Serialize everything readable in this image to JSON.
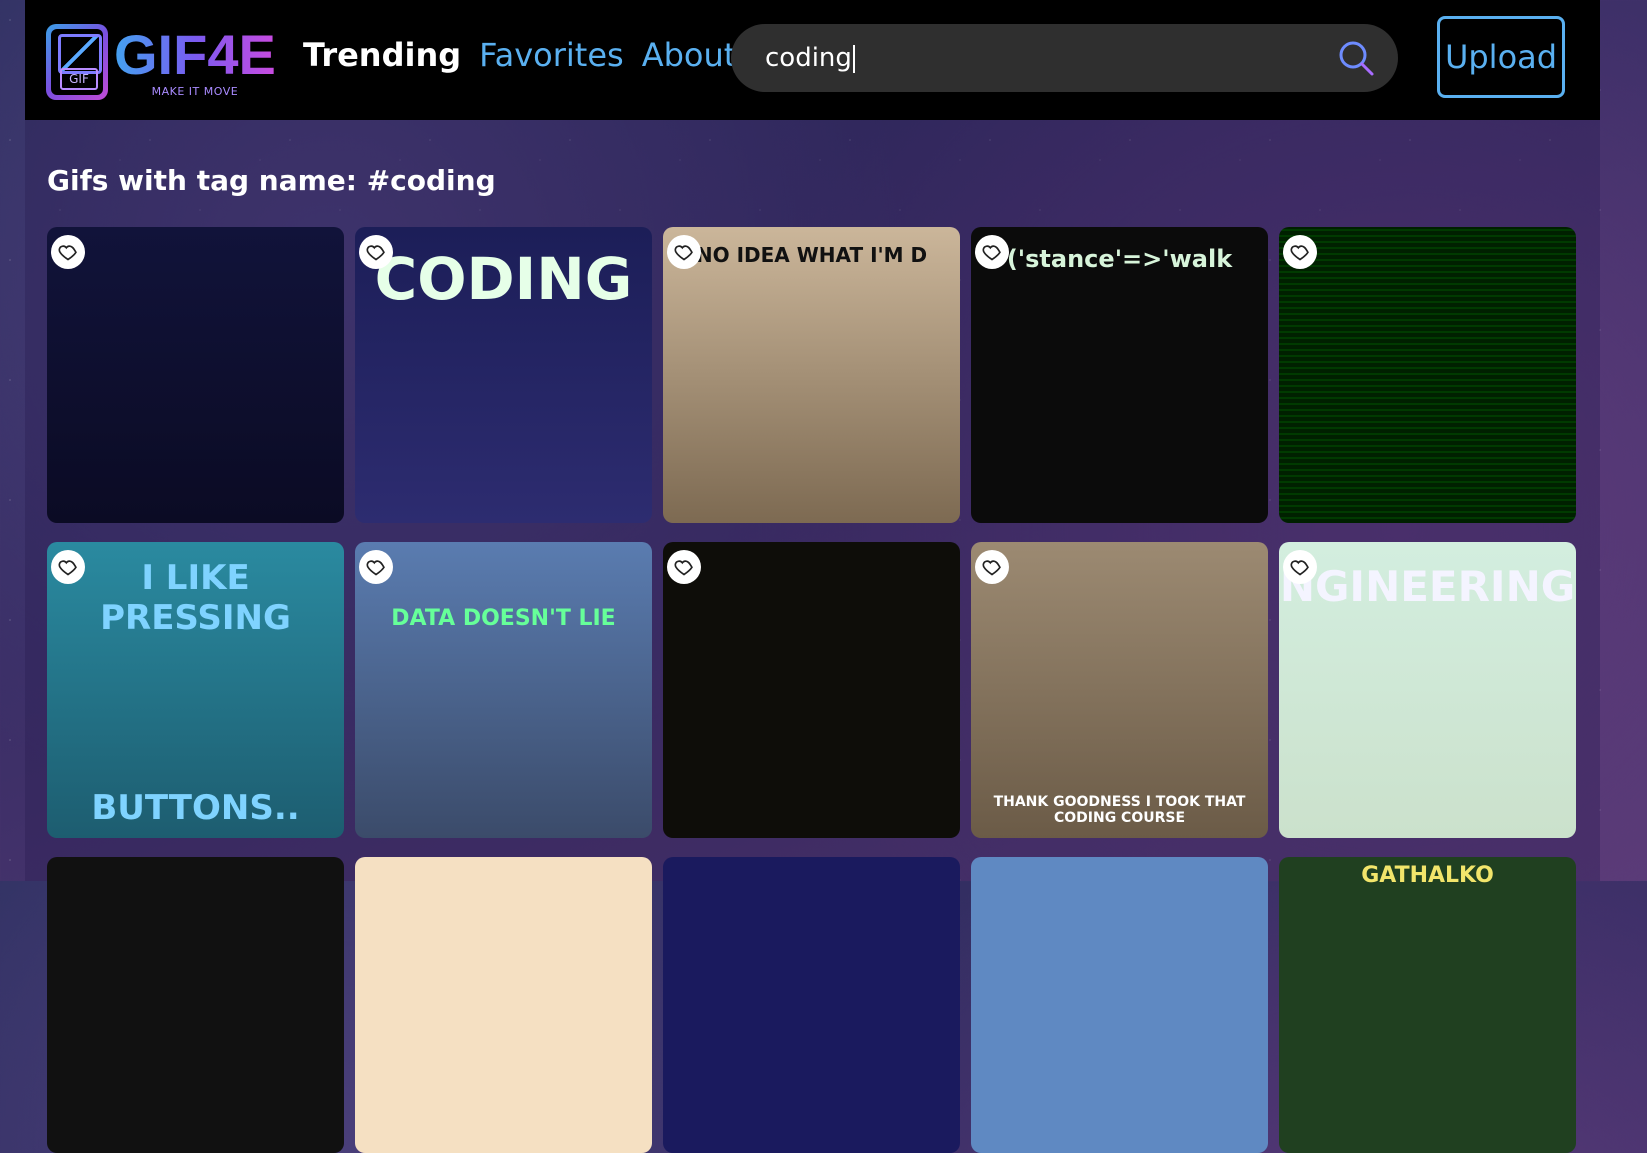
{
  "header": {
    "logo": {
      "title": "GIF4E",
      "subtitle": "MAKE IT MOVE",
      "badge_text": "GIF"
    },
    "nav": {
      "trending": "Trending",
      "favorites": "Favorites",
      "about": "About"
    },
    "search": {
      "value": "coding"
    },
    "upload_label": "Upload"
  },
  "main": {
    "title": "Gifs with tag name: #coding",
    "gifs": [
      {
        "caption": "",
        "bg": "#0f1230"
      },
      {
        "caption": "CODING",
        "bg": "#1c1e58"
      },
      {
        "caption": "NO IDEA WHAT I'M D",
        "bg": "#bfa98a"
      },
      {
        "caption": "('stance'=>'walk",
        "bg": "#0b0b0b"
      },
      {
        "caption": "",
        "bg": "#001800"
      },
      {
        "caption": "I LIKE PRESSING",
        "caption2": "BUTTONS..",
        "bg": "#2a8aa0"
      },
      {
        "caption": "DATA DOESN'T LIE",
        "bg": "#4a6fa5"
      },
      {
        "caption": "",
        "bg": "#0e0d09"
      },
      {
        "caption": "THANK GOODNESS I TOOK THAT CODING COURSE",
        "bg": "#8d7a62"
      },
      {
        "caption": "NGINEERING",
        "bg": "#cfe3d2"
      },
      {
        "caption": "",
        "bg": "#111"
      },
      {
        "caption": "",
        "bg": "#f5e0c2"
      },
      {
        "caption": "",
        "bg": "#1a1a5e"
      },
      {
        "caption": "",
        "bg": "#5f89c2"
      },
      {
        "caption": "GATHALKO",
        "bg": "#204020"
      }
    ]
  }
}
